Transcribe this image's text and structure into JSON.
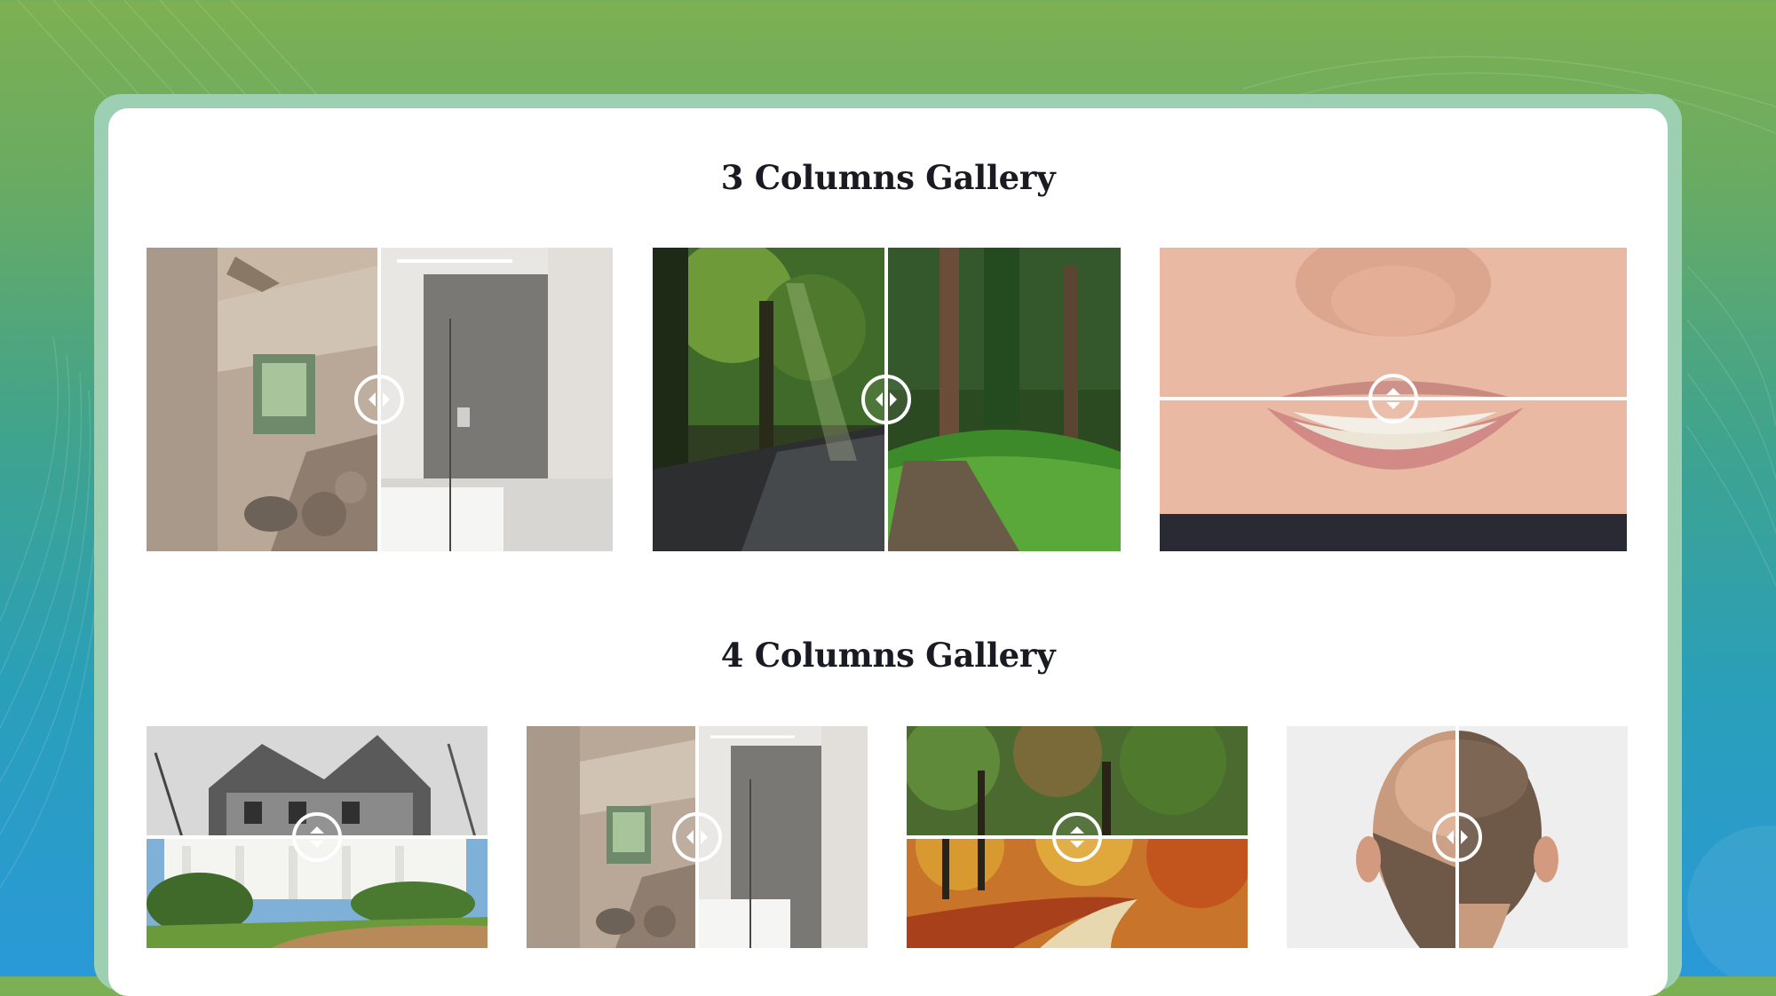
{
  "sections": [
    {
      "title": "3 Columns Gallery"
    },
    {
      "title": "4 Columns Gallery"
    }
  ],
  "galleries": {
    "three_columns": [
      {
        "subject": "bathroom renovation",
        "orientation": "horizontal",
        "slider_position": 0.5
      },
      {
        "subject": "forest path",
        "orientation": "horizontal",
        "slider_position": 0.5
      },
      {
        "subject": "teeth whitening",
        "orientation": "vertical",
        "slider_position": 0.5
      }
    ],
    "four_columns": [
      {
        "subject": "house restoration",
        "orientation": "vertical",
        "slider_position": 0.5
      },
      {
        "subject": "bathroom renovation",
        "orientation": "horizontal",
        "slider_position": 0.5
      },
      {
        "subject": "autumn forest",
        "orientation": "vertical",
        "slider_position": 0.5
      },
      {
        "subject": "hair restoration",
        "orientation": "horizontal",
        "slider_position": 0.5
      }
    ]
  },
  "icons": {
    "handle_horizontal": "left-right-arrows-icon",
    "handle_vertical": "up-down-arrows-icon"
  },
  "colors": {
    "background_top": "#7db052",
    "background_bottom": "#2a99d8",
    "card": "#ffffff",
    "card_border": "#9dcfb3",
    "title": "#1a1a22"
  }
}
